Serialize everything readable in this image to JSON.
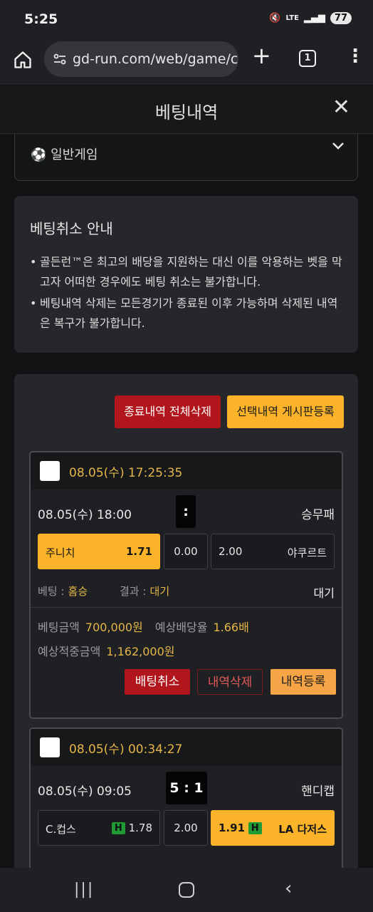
{
  "status": {
    "time": "5:25",
    "network": "LTE",
    "battery": "77"
  },
  "browser": {
    "url": "gd-run.com/web/game/c",
    "tab_count": "1"
  },
  "modal": {
    "title": "베팅내역"
  },
  "filter": {
    "selected": "일반게임"
  },
  "notice": {
    "title": "베팅취소 안내",
    "items": [
      "골든런™은 최고의 배당을 지원하는 대신 이를 악용하는 벳을 막고자 어떠한 경우에도 베팅 취소는 불가합니다.",
      "베팅내역 삭제는 모든경기가 종료된 이후 가능하며 삭제된 내역은 복구가 불가합니다."
    ]
  },
  "actions": {
    "delete_all": "종료내역 전체삭제",
    "register_selected": "선택내역 게시판등록"
  },
  "cards": [
    {
      "bet_time": "08.05(수) 17:25:35",
      "match_time": "08.05(수) 18:00",
      "score": ":",
      "market": "승무패",
      "home": {
        "name": "주니치",
        "odds": "1.71"
      },
      "draw": "0.00",
      "away": {
        "name": "야쿠르트",
        "odds": "2.00"
      },
      "bet_label": "베팅 :",
      "bet_value": "홈승",
      "result_label": "결과 :",
      "result_value": "대기",
      "status": "대기",
      "amount_label": "베팅금액",
      "amount_value": "700,000원",
      "expected_odds_label": "예상배당율",
      "expected_odds_value": "1.66배",
      "expected_win_label": "예상적중금액",
      "expected_win_value": "1,162,000원",
      "cancel": "배팅취소",
      "delete": "내역삭제",
      "register": "내역등록"
    },
    {
      "bet_time": "08.05(수) 00:34:27",
      "match_time": "08.05(수) 09:05",
      "score": "5 : 1",
      "market": "핸디캡",
      "home": {
        "name": "C.컵스",
        "badge": "H",
        "odds": "1.78"
      },
      "draw": "2.00",
      "away": {
        "name": "LA 다저스",
        "badge": "H",
        "odds": "1.91"
      }
    }
  ],
  "colors": {
    "accent_yellow": "#fbb32a",
    "accent_red": "#b0161b",
    "text_gold": "#e5b548"
  }
}
